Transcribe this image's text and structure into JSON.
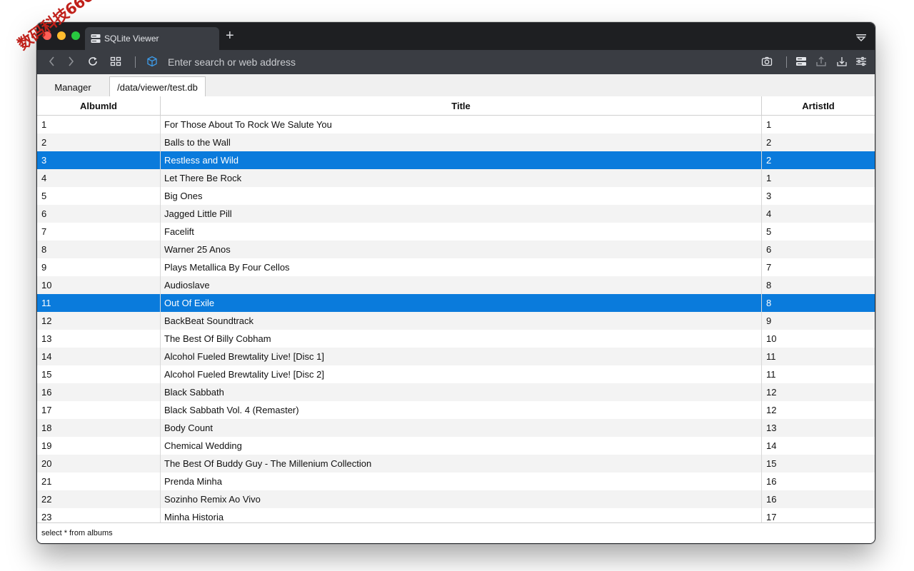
{
  "watermark": "数码科技666",
  "window": {
    "tab_title": "SQLite Viewer",
    "new_tab_symbol": "+"
  },
  "toolbar": {
    "address_placeholder": "Enter search or web address"
  },
  "page_tabs": [
    "Manager",
    "/data/viewer/test.db"
  ],
  "table": {
    "columns": [
      "AlbumId",
      "Title",
      "ArtistId"
    ],
    "rows": [
      {
        "id": "1",
        "title": "For Those About To Rock We Salute You",
        "artist": "1"
      },
      {
        "id": "2",
        "title": "Balls to the Wall",
        "artist": "2"
      },
      {
        "id": "3",
        "title": "Restless and Wild",
        "artist": "2"
      },
      {
        "id": "4",
        "title": "Let There Be Rock",
        "artist": "1"
      },
      {
        "id": "5",
        "title": "Big Ones",
        "artist": "3"
      },
      {
        "id": "6",
        "title": "Jagged Little Pill",
        "artist": "4"
      },
      {
        "id": "7",
        "title": "Facelift",
        "artist": "5"
      },
      {
        "id": "8",
        "title": "Warner 25 Anos",
        "artist": "6"
      },
      {
        "id": "9",
        "title": "Plays Metallica By Four Cellos",
        "artist": "7"
      },
      {
        "id": "10",
        "title": "Audioslave",
        "artist": "8"
      },
      {
        "id": "11",
        "title": "Out Of Exile",
        "artist": "8"
      },
      {
        "id": "12",
        "title": "BackBeat Soundtrack",
        "artist": "9"
      },
      {
        "id": "13",
        "title": "The Best Of Billy Cobham",
        "artist": "10"
      },
      {
        "id": "14",
        "title": "Alcohol Fueled Brewtality Live! [Disc 1]",
        "artist": "11"
      },
      {
        "id": "15",
        "title": "Alcohol Fueled Brewtality Live! [Disc 2]",
        "artist": "11"
      },
      {
        "id": "16",
        "title": "Black Sabbath",
        "artist": "12"
      },
      {
        "id": "17",
        "title": "Black Sabbath Vol. 4 (Remaster)",
        "artist": "12"
      },
      {
        "id": "18",
        "title": "Body Count",
        "artist": "13"
      },
      {
        "id": "19",
        "title": "Chemical Wedding",
        "artist": "14"
      },
      {
        "id": "20",
        "title": "The Best Of Buddy Guy - The Millenium Collection",
        "artist": "15"
      },
      {
        "id": "21",
        "title": "Prenda Minha",
        "artist": "16"
      },
      {
        "id": "22",
        "title": "Sozinho Remix Ao Vivo",
        "artist": "16"
      },
      {
        "id": "23",
        "title": "Minha Historia",
        "artist": "17"
      }
    ],
    "selected_ids": [
      "3",
      "11"
    ]
  },
  "status": {
    "query": "select * from albums"
  },
  "colors": {
    "selection": "#0a7bdc",
    "titlebar": "#1e1f22",
    "toolbar": "#3a3d43",
    "traffic_red": "#fe5f57",
    "traffic_yellow": "#febc2e",
    "traffic_green": "#28c840"
  },
  "icons": [
    "back-icon",
    "forward-icon",
    "reload-icon",
    "grid-icon",
    "cube-icon",
    "camera-icon",
    "database-icon",
    "share-icon",
    "download-icon",
    "settings-sliders-icon",
    "tab-menu-icon"
  ]
}
